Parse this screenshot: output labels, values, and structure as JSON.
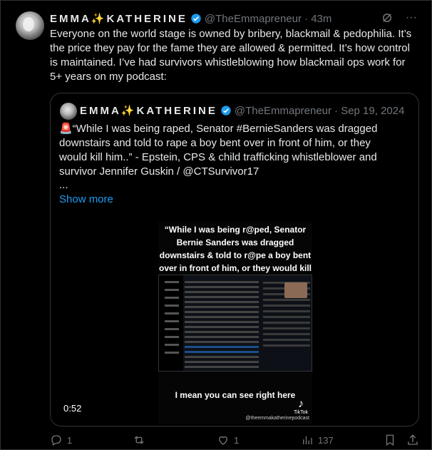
{
  "post": {
    "display_name": "EMMA✨KATHERINE",
    "handle": "@TheEmmapreneur",
    "time": "· 43m",
    "text": "Everyone on the world stage is owned by bribery, blackmail & pedophilia. It’s the price they pay for the fame they are allowed & permitted. It’s how control is maintained. I’ve had survivors whistleblowing how blackmail ops work for 5+ years on my podcast:"
  },
  "quote": {
    "display_name": "EMMA✨KATHERINE",
    "handle": "@TheEmmapreneur",
    "date": "· Sep 19, 2024",
    "text": "🚨“While I was being raped, Senator #BernieSanders was dragged downstairs and told to rape a boy bent over in front of him, or they would kill him..” - Epstein, CPS & child trafficking whistleblower and survivor Jennifer Guskin / @CTSurvivor17",
    "ellipsis": "...",
    "show_more": "Show more",
    "video": {
      "caption": "“While I was being r@ped, Senator Bernie Sanders was dragged downstairs & told to r@pe a boy bent over in front of him, or they would kill him…”",
      "bottom_caption": "I mean you can see right here",
      "tiktok_label": "TikTok",
      "tiktok_handle": "@theemmakatherinepodcast",
      "duration": "0:52"
    }
  },
  "actions": {
    "replies": "1",
    "reposts": "",
    "likes": "1",
    "views": "137"
  }
}
